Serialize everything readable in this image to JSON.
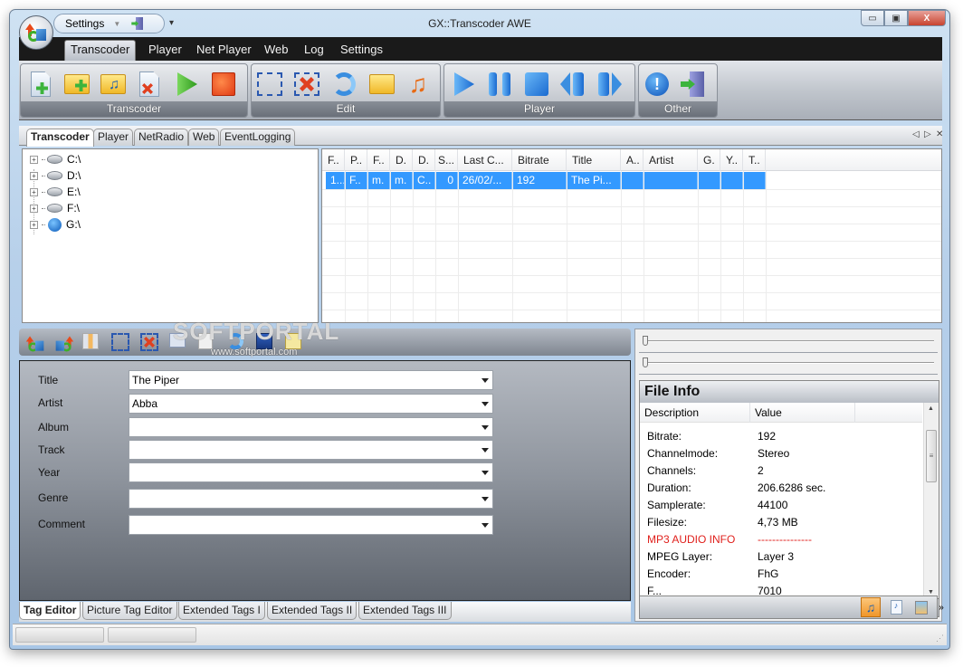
{
  "window": {
    "title": "GX::Transcoder AWE",
    "controls": {
      "minimize": "▭",
      "maximize": "▣",
      "close": "X"
    }
  },
  "quick_access": {
    "label": "Settings",
    "more": "▾"
  },
  "menu": {
    "items": [
      {
        "label": "Transcoder",
        "active": true
      },
      {
        "label": "Player"
      },
      {
        "label": "Net Player"
      },
      {
        "label": "Web"
      },
      {
        "label": "Log"
      },
      {
        "label": "Settings"
      }
    ]
  },
  "ribbon": {
    "groups": [
      {
        "label": "Transcoder",
        "buttons": [
          "add-file",
          "add-folder",
          "add-music-folder",
          "remove-file",
          "start",
          "stop"
        ]
      },
      {
        "label": "Edit",
        "buttons": [
          "select-all",
          "deselect",
          "refresh",
          "open-folder",
          "music"
        ]
      },
      {
        "label": "Player",
        "buttons": [
          "play",
          "pause",
          "stop",
          "previous",
          "next"
        ]
      },
      {
        "label": "Other",
        "buttons": [
          "about",
          "exit"
        ]
      }
    ]
  },
  "doc_tabs": {
    "items": [
      "Transcoder",
      "Player",
      "NetRadio",
      "Web",
      "EventLogging"
    ],
    "active": "Transcoder",
    "controls": {
      "prev": "◁",
      "next": "▷",
      "close": "✕"
    }
  },
  "tree": {
    "drives": [
      {
        "label": "C:\\",
        "type": "hard-drive"
      },
      {
        "label": "D:\\",
        "type": "hard-drive"
      },
      {
        "label": "E:\\",
        "type": "hard-drive"
      },
      {
        "label": "F:\\",
        "type": "hard-drive"
      },
      {
        "label": "G:\\",
        "type": "media-drive"
      }
    ]
  },
  "grid": {
    "columns": [
      "F..",
      "P..",
      "F..",
      "D.",
      "D.",
      "S...",
      "Last C...",
      "Bitrate",
      "Title",
      "A..",
      "Artist",
      "G.",
      "Y..",
      "T.."
    ],
    "rows": [
      [
        "1...",
        "F..",
        "m.",
        "m.",
        "C..",
        "0",
        "26/02/...",
        "192",
        "The Pi...",
        "",
        "",
        "",
        "",
        ""
      ]
    ]
  },
  "watermark": {
    "text": "SOFTPORTAL",
    "url": "www.softportal.com"
  },
  "tag_editor": {
    "fields": [
      {
        "label": "Title",
        "value": "The Piper"
      },
      {
        "label": "Artist",
        "value": "Abba"
      },
      {
        "label": "Album",
        "value": ""
      },
      {
        "label": "Track",
        "value": ""
      },
      {
        "label": "Year",
        "value": ""
      },
      {
        "label": "Genre",
        "value": ""
      },
      {
        "label": "Comment",
        "value": ""
      }
    ],
    "tabs": [
      "Tag Editor",
      "Picture Tag Editor",
      "Extended Tags I",
      "Extended Tags II",
      "Extended Tags III"
    ],
    "active_tab": "Tag Editor"
  },
  "file_info": {
    "title": "File Info",
    "columns": [
      "Description",
      "Value"
    ],
    "rows": [
      {
        "desc": "Bitrate:",
        "value": "192"
      },
      {
        "desc": "Channelmode:",
        "value": "Stereo"
      },
      {
        "desc": "Channels:",
        "value": "2"
      },
      {
        "desc": "Duration:",
        "value": "206.6286 sec."
      },
      {
        "desc": "Samplerate:",
        "value": "44100"
      },
      {
        "desc": "Filesize:",
        "value": "4,73 MB"
      },
      {
        "desc": "MP3 AUDIO INFO",
        "value": "---------------",
        "highlight": true
      },
      {
        "desc": "MPEG Layer:",
        "value": "Layer 3"
      },
      {
        "desc": "Encoder:",
        "value": "FhG"
      },
      {
        "desc": "F...",
        "value": "7010"
      }
    ],
    "sliders": [
      {
        "value": 0
      },
      {
        "value": 0
      }
    ]
  },
  "colors": {
    "selection": "#3399ff",
    "menubar": "#1a1a1a",
    "highlight_text": "#e0201c"
  }
}
